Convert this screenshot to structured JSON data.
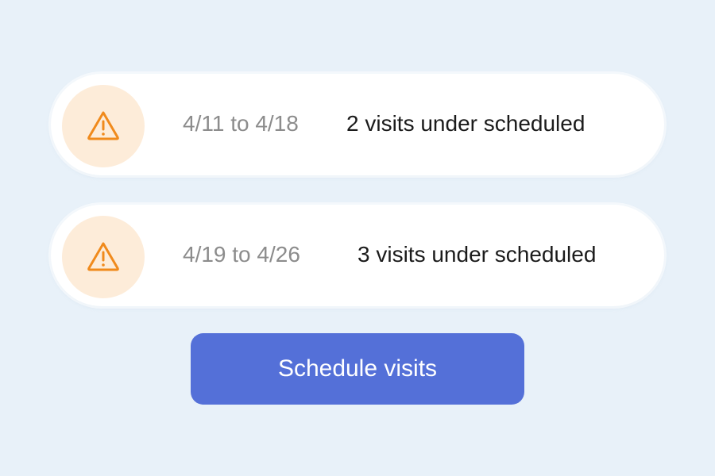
{
  "alerts": [
    {
      "icon": "warning-triangle-icon",
      "date_range": "4/11 to 4/18",
      "message": "2 visits under scheduled"
    },
    {
      "icon": "warning-triangle-icon",
      "date_range": "4/19 to 4/26",
      "message": "3 visits under scheduled"
    }
  ],
  "schedule_button": {
    "label": "Schedule visits"
  },
  "colors": {
    "background": "#e8f1f9",
    "card": "#ffffff",
    "icon_circle": "#fdecd9",
    "warning_accent": "#f08a1c",
    "date_text": "#8c8c8c",
    "message_text": "#1b1b1b",
    "button": "#5470d8",
    "button_text": "#ffffff"
  }
}
